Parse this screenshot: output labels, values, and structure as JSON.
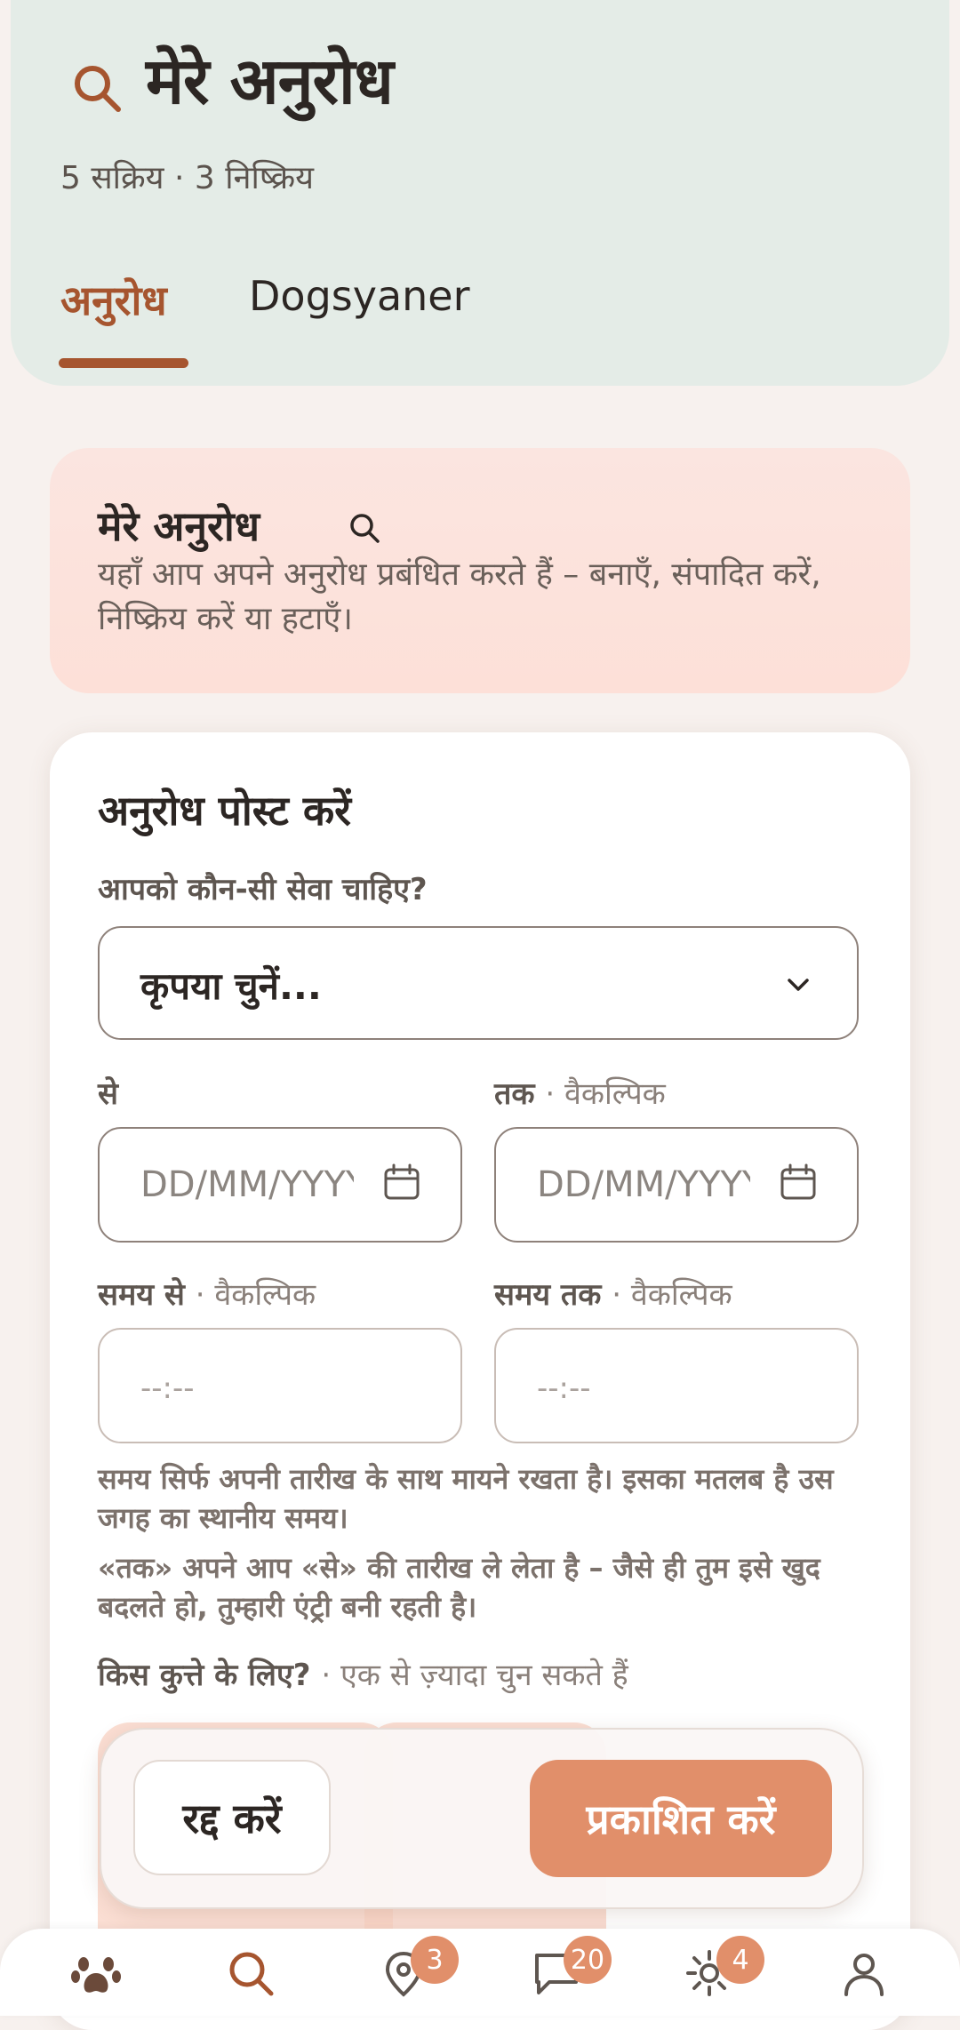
{
  "header": {
    "title": "मेरे अनुरोध",
    "subtitle": "5 सक्रिय · 3 निष्क्रिय",
    "tabs": [
      {
        "label": "अनुरोध",
        "active": true
      },
      {
        "label": "Dogsyaner",
        "active": false
      }
    ]
  },
  "info_card": {
    "title": "मेरे अनुरोध",
    "text": "यहाँ आप अपने अनुरोध प्रबंधित करते हैं – बनाएँ, संपादित करें, निष्क्रिय करें या हटाएँ।"
  },
  "form": {
    "title": "अनुरोध पोस्ट करें",
    "service_label": "आपको कौन-सी सेवा चाहिए?",
    "service_value": "कृपया चुनें...",
    "from_label": "से",
    "to_label": "तक",
    "optional": "· वैकल्पिक",
    "date_placeholder": "DD/MM/YYYY",
    "time_from_label": "समय से",
    "time_to_label": "समय तक",
    "time_placeholder": "--:--",
    "help_1": "समय सिर्फ अपनी तारीख के साथ मायने रखता है। इसका मतलब है उस जगह का स्थानीय समय।",
    "help_2": "«तक» अपने आप «से» की तारीख ले लेता है – जैसे ही तुम इसे खुद बदलते हो, तुम्हारी एंट्री बनी रहती है।",
    "dogs_label": "किस कुत्ते के लिए?",
    "dogs_hint": "· एक से ज़्यादा चुन सकते हैं"
  },
  "actions": {
    "cancel": "रद्द करें",
    "publish": "प्रकाशित करें"
  },
  "nav": {
    "items": [
      {
        "icon": "paw-icon"
      },
      {
        "icon": "search-icon"
      },
      {
        "icon": "map-pin-icon",
        "badge": "3"
      },
      {
        "icon": "chat-icon",
        "badge": "20"
      },
      {
        "icon": "sun-icon",
        "badge": "4"
      },
      {
        "icon": "user-icon"
      }
    ]
  },
  "colors": {
    "accent": "#a6552f",
    "primary_button": "#e18f6a",
    "header_bg": "#e4ece7",
    "info_bg": "#fde0d8"
  }
}
